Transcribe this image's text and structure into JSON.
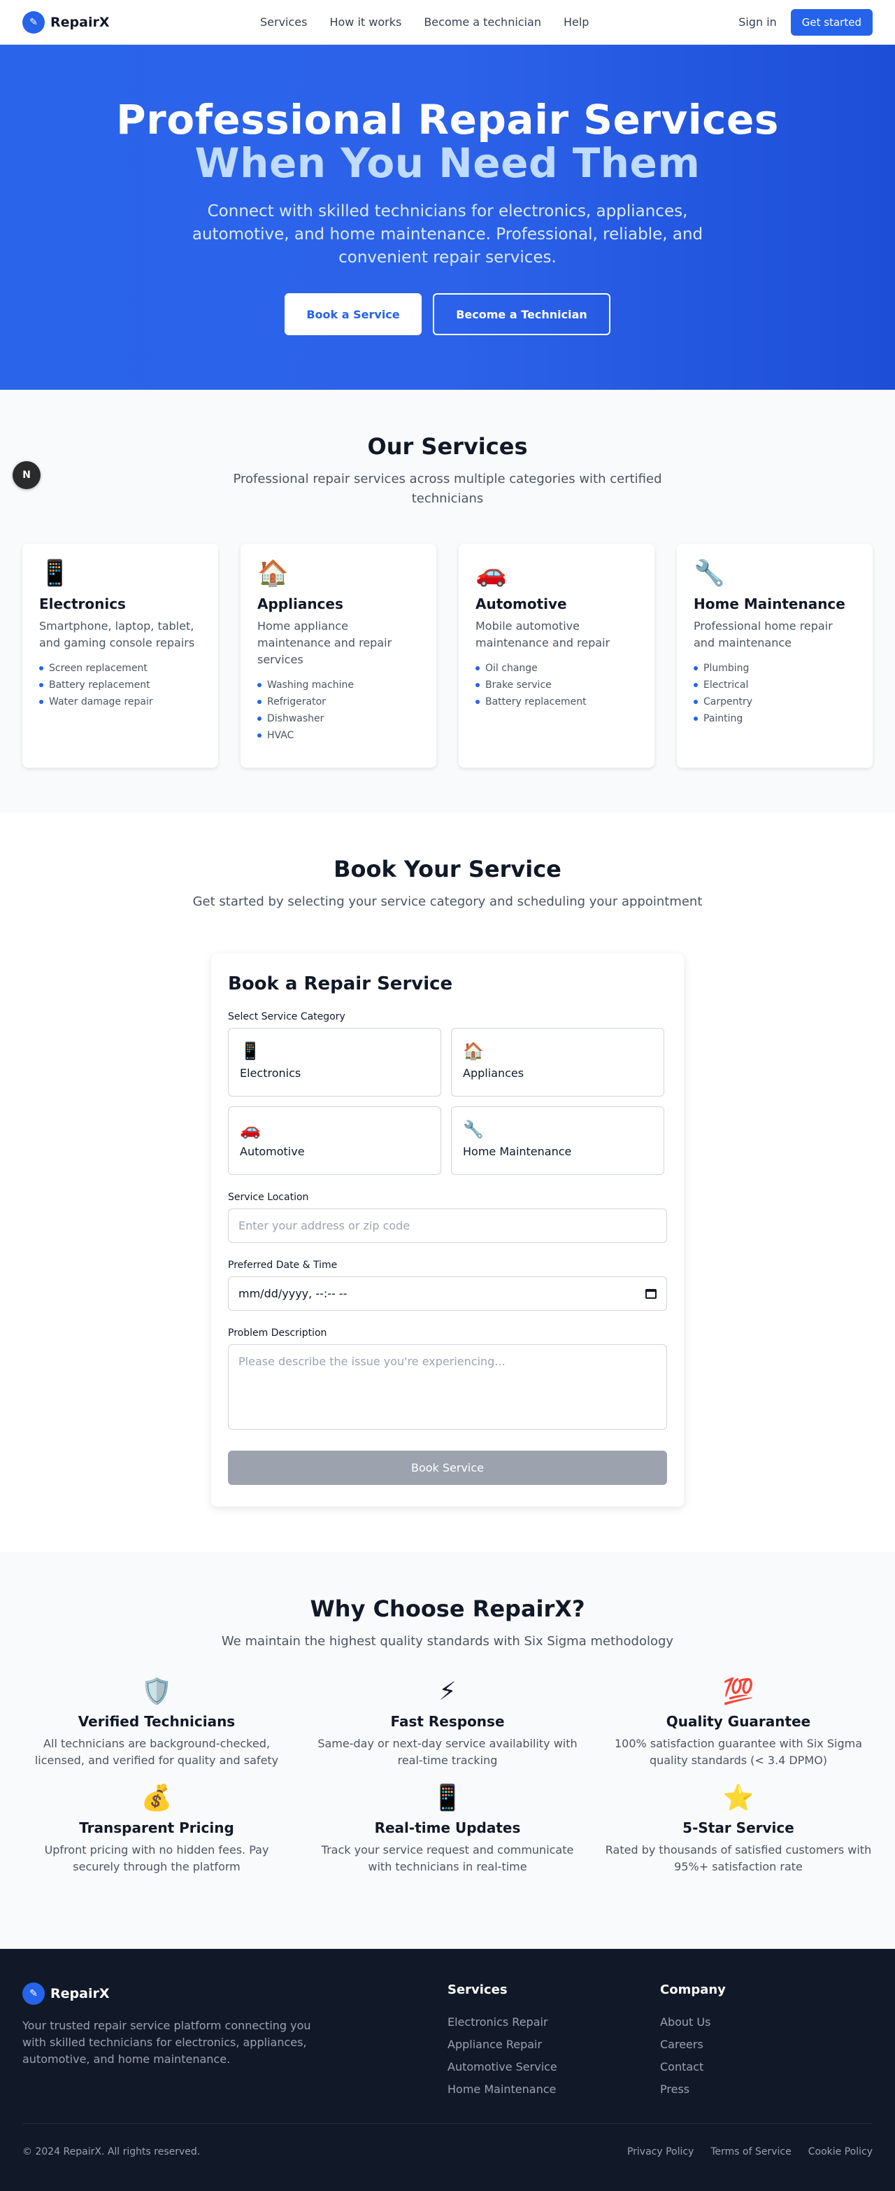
{
  "nav": {
    "brand": "RepairX",
    "links": [
      "Services",
      "How it works",
      "Become a technician",
      "Help"
    ],
    "signin": "Sign in",
    "cta": "Get started"
  },
  "hero": {
    "title_line1": "Professional Repair Services",
    "title_line2": "When You Need Them",
    "subtitle": "Connect with skilled technicians for electronics, appliances, automotive, and home maintenance. Professional, reliable, and convenient repair services.",
    "btn_book": "Book a Service",
    "btn_tech": "Become a Technician"
  },
  "badge": "N",
  "services": {
    "title": "Our Services",
    "subtitle": "Professional repair services across multiple categories with certified technicians",
    "cards": [
      {
        "icon": "📱",
        "title": "Electronics",
        "desc": "Smartphone, laptop, tablet, and gaming console repairs",
        "items": [
          "Screen replacement",
          "Battery replacement",
          "Water damage repair"
        ]
      },
      {
        "icon": "🏠",
        "title": "Appliances",
        "desc": "Home appliance maintenance and repair services",
        "items": [
          "Washing machine",
          "Refrigerator",
          "Dishwasher",
          "HVAC"
        ]
      },
      {
        "icon": "🚗",
        "title": "Automotive",
        "desc": "Mobile automotive maintenance and repair",
        "items": [
          "Oil change",
          "Brake service",
          "Battery replacement"
        ]
      },
      {
        "icon": "🔧",
        "title": "Home Maintenance",
        "desc": "Professional home repair and maintenance",
        "items": [
          "Plumbing",
          "Electrical",
          "Carpentry",
          "Painting"
        ]
      }
    ]
  },
  "book": {
    "title": "Book Your Service",
    "subtitle": "Get started by selecting your service category and scheduling your appointment",
    "form": {
      "title": "Book a Repair Service",
      "category_label": "Select Service Category",
      "categories": [
        {
          "icon": "📱",
          "label": "Electronics"
        },
        {
          "icon": "🏠",
          "label": "Appliances"
        },
        {
          "icon": "🚗",
          "label": "Automotive"
        },
        {
          "icon": "🔧",
          "label": "Home Maintenance"
        }
      ],
      "location_label": "Service Location",
      "location_placeholder": "Enter your address or zip code",
      "datetime_label": "Preferred Date & Time",
      "datetime_value": "mm/dd/yyyy, --:-- --",
      "desc_label": "Problem Description",
      "desc_placeholder": "Please describe the issue you're experiencing...",
      "submit": "Book Service"
    }
  },
  "why": {
    "title": "Why Choose RepairX?",
    "subtitle": "We maintain the highest quality standards with Six Sigma methodology",
    "features": [
      {
        "icon": "🛡️",
        "title": "Verified Technicians",
        "desc": "All technicians are background-checked, licensed, and verified for quality and safety"
      },
      {
        "icon": "⚡",
        "title": "Fast Response",
        "desc": "Same-day or next-day service availability with real-time tracking"
      },
      {
        "icon": "💯",
        "title": "Quality Guarantee",
        "desc": "100% satisfaction guarantee with Six Sigma quality standards (< 3.4 DPMO)"
      },
      {
        "icon": "💰",
        "title": "Transparent Pricing",
        "desc": "Upfront pricing with no hidden fees. Pay securely through the platform"
      },
      {
        "icon": "📱",
        "title": "Real-time Updates",
        "desc": "Track your service request and communicate with technicians in real-time"
      },
      {
        "icon": "⭐",
        "title": "5-Star Service",
        "desc": "Rated by thousands of satisfied customers with 95%+ satisfaction rate"
      }
    ]
  },
  "footer": {
    "brand": "RepairX",
    "desc": "Your trusted repair service platform connecting you with skilled technicians for electronics, appliances, automotive, and home maintenance.",
    "services_title": "Services",
    "services": [
      "Electronics Repair",
      "Appliance Repair",
      "Automotive Service",
      "Home Maintenance"
    ],
    "company_title": "Company",
    "company": [
      "About Us",
      "Careers",
      "Contact",
      "Press"
    ],
    "copyright": "© 2024 RepairX. All rights reserved.",
    "legal": [
      "Privacy Policy",
      "Terms of Service",
      "Cookie Policy"
    ]
  },
  "colors": {
    "primary": "#2563eb",
    "footer_bg": "#111827",
    "hero_accent": "#bfdbfe",
    "disabled": "#9ca3af"
  }
}
